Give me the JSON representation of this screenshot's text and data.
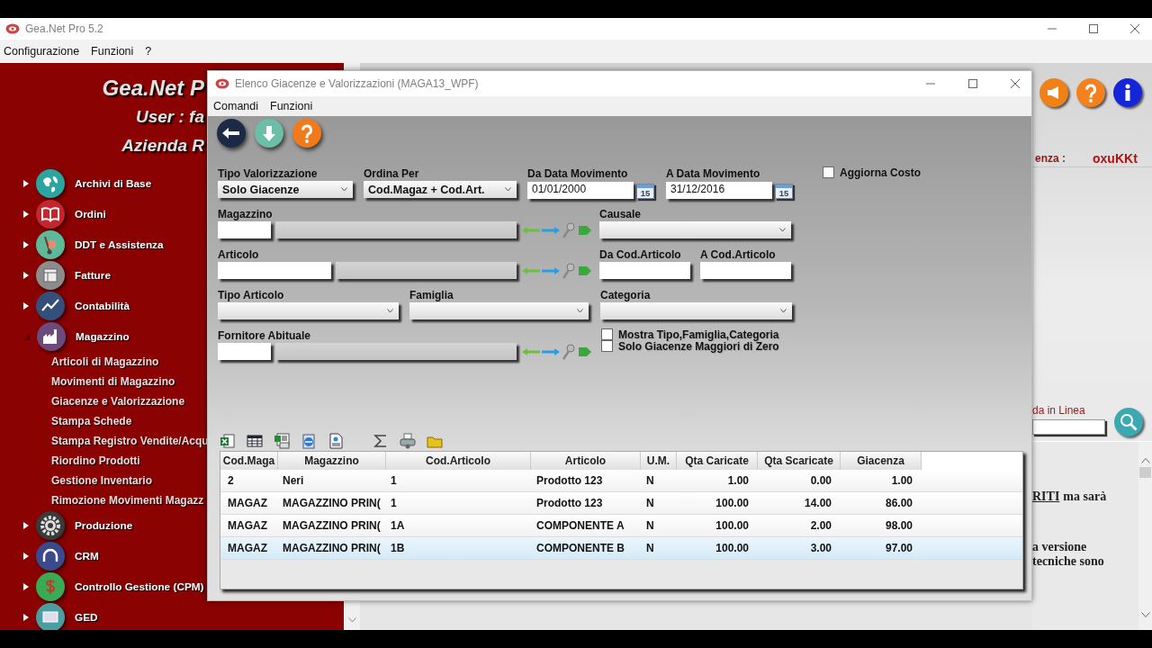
{
  "app": {
    "title": "Gea.Net Pro 5.2",
    "menu": [
      "Configurazione",
      "Funzioni",
      "?"
    ]
  },
  "sidebar": {
    "header": [
      "Gea.Net P",
      "User : fa",
      "Azienda R"
    ],
    "items": [
      {
        "label": "Archivi di Base",
        "expanded": false
      },
      {
        "label": "Ordini",
        "expanded": false
      },
      {
        "label": "DDT e Assistenza",
        "expanded": false
      },
      {
        "label": "Fatture",
        "expanded": false
      },
      {
        "label": "Contabilità",
        "expanded": false
      },
      {
        "label": "Magazzino",
        "expanded": true,
        "children": [
          {
            "label": "Articoli di Magazzino"
          },
          {
            "label": "Movimenti di Magazzino"
          },
          {
            "label": "Giacenze e Valorizzazione"
          },
          {
            "label": "Stampa Schede"
          },
          {
            "label": "Stampa Registro Vendite/Acqu"
          },
          {
            "label": "Riordino Prodotti"
          },
          {
            "label": "Gestione Inventario"
          },
          {
            "label": "Rimozione Movimenti Magazz"
          }
        ]
      },
      {
        "label": "Produzione",
        "expanded": false
      },
      {
        "label": "CRM",
        "expanded": false
      },
      {
        "label": "Controllo Gestione (CPM)",
        "expanded": false
      },
      {
        "label": "GED",
        "expanded": false
      }
    ]
  },
  "background_panel": {
    "license_label": "enza :",
    "license_code": "oxuKKt",
    "search_label": "da in Linea",
    "text_lines": [
      {
        "link": "RITI",
        "text": "ma sarà"
      },
      {
        "text": "a versione"
      },
      {
        "text": "tecniche sono"
      }
    ]
  },
  "dialog": {
    "title": "Elenco Giacenze e Valorizzazioni (MAGA13_WPF)",
    "menu": [
      "Comandi",
      "Funzioni"
    ],
    "form": {
      "groups": [
        {
          "fields": [
            {
              "kind": "combo",
              "label": "Tipo Valorizzazione",
              "value": "Solo Giacenze"
            },
            {
              "kind": "combo",
              "label": "Ordina Per",
              "value": "Cod.Magaz + Cod.Art."
            },
            {
              "kind": "date",
              "label": "Da Data Movimento",
              "value": "01/01/2000",
              "calendar_day": "15"
            },
            {
              "kind": "date",
              "label": "A Data Movimento",
              "value": "31/12/2016",
              "calendar_day": "15"
            },
            {
              "kind": "checkgroup",
              "items": [
                {
                  "label": "Aggiorna Costo",
                  "checked": false
                }
              ]
            }
          ]
        },
        {
          "fields": [
            {
              "kind": "lookup",
              "label": "Magazzino"
            },
            {
              "kind": "combo",
              "label": "Causale"
            }
          ]
        },
        {
          "fields": [
            {
              "kind": "lookup",
              "label": "Articolo"
            },
            {
              "kind": "text",
              "label": "Da Cod.Articolo"
            },
            {
              "kind": "text",
              "label": "A Cod.Articolo"
            }
          ]
        },
        {
          "fields": [
            {
              "kind": "combo",
              "label": "Tipo Articolo"
            },
            {
              "kind": "combo",
              "label": "Famiglia"
            },
            {
              "kind": "combo",
              "label": "Categoria"
            }
          ]
        },
        {
          "fields": [
            {
              "kind": "lookup",
              "label": "Fornitore Abituale"
            },
            {
              "kind": "checkgroup",
              "items": [
                {
                  "label": "Mostra Tipo,Famiglia,Categoria",
                  "checked": false
                },
                {
                  "label": "Solo Giacenze Maggiori di Zero",
                  "checked": false
                }
              ]
            }
          ]
        }
      ]
    },
    "table": {
      "columns": [
        "Cod.Maga",
        "Magazzino",
        "Cod.Articolo",
        "Articolo",
        "U.M.",
        "Qta Caricate",
        "Qta Scaricate",
        "Giacenza"
      ],
      "rows": [
        {
          "cells": [
            "2",
            "Neri",
            "1",
            "Prodotto 123",
            "N",
            "1.00",
            "0.00",
            "1.00"
          ],
          "selected": false
        },
        {
          "cells": [
            "MAGAZ",
            "MAGAZZINO PRIN(",
            "1",
            "Prodotto 123",
            "N",
            "100.00",
            "14.00",
            "86.00"
          ],
          "selected": false
        },
        {
          "cells": [
            "MAGAZ",
            "MAGAZZINO PRIN(",
            "1A",
            "COMPONENTE A",
            "N",
            "100.00",
            "2.00",
            "98.00"
          ],
          "selected": false
        },
        {
          "cells": [
            "MAGAZ",
            "MAGAZZINO PRIN(",
            "1B",
            "COMPONENTE B",
            "N",
            "100.00",
            "3.00",
            "97.00"
          ],
          "selected": true
        }
      ]
    }
  }
}
